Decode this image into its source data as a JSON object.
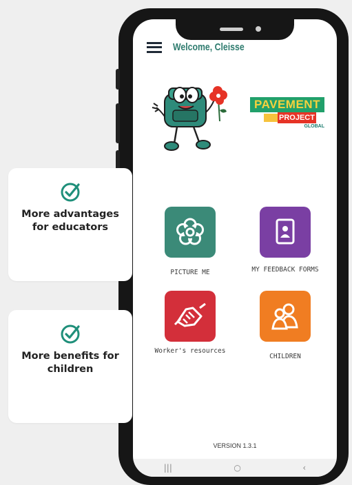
{
  "header": {
    "welcome": "Welcome, Cleisse"
  },
  "logo": {
    "line1": "PAVEMENT",
    "line2": "PROJECT",
    "line3": "GLOBAL"
  },
  "tiles": [
    {
      "label": "PICTURE ME",
      "icon": "flower-icon",
      "color": "#3b8a78"
    },
    {
      "label": "MY FEEDBACK FORMS",
      "icon": "portrait-document-icon",
      "color": "#7a3fa3"
    },
    {
      "label": "Worker's resources",
      "icon": "handshake-icon",
      "color": "#d32f3a"
    },
    {
      "label": "CHILDREN",
      "icon": "people-icon",
      "color": "#f07d22"
    }
  ],
  "footer": {
    "version": "VERSION  1.3.1"
  },
  "android_nav": {
    "recents": "|||",
    "home": "○",
    "back": "‹"
  },
  "cards": [
    {
      "text": "More advantages for educators",
      "icon": "check-circle-icon"
    },
    {
      "text": "More benefits for children",
      "icon": "check-circle-icon"
    }
  ],
  "colors": {
    "accent_green": "#2e7b6e",
    "check_green": "#1f8f7a",
    "page_bg": "#efefef"
  }
}
